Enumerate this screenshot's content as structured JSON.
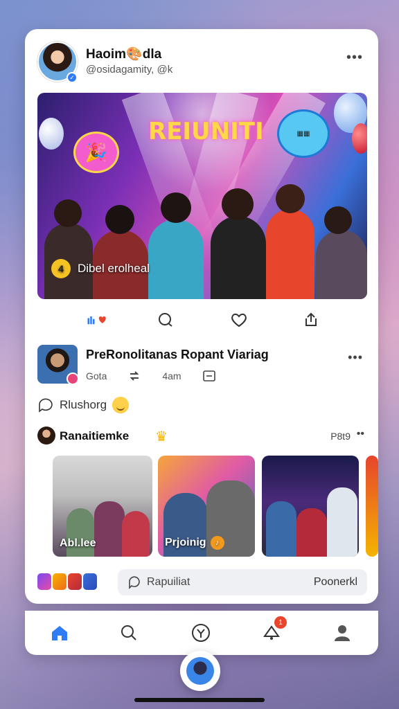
{
  "post": {
    "author_name": "Haoim🎨dla",
    "author_handle": "@osidagamity, @k",
    "more_icon": "more-horizontal-icon",
    "hero": {
      "title": "REIUNITI",
      "caption": "Dibel erolheal",
      "caption_badge": "4",
      "bubble_left": "🎉",
      "bubble_right_top": "▦▦",
      "bubble_right_bottom": "▦▦"
    },
    "actions": [
      "like-reactions-icon",
      "comment-icon",
      "heart-icon",
      "share-icon"
    ]
  },
  "comment": {
    "title": "PreRonolitanas Ropant Viariag",
    "meta": {
      "count": "Gota",
      "time": "4am"
    },
    "icons": [
      "repost-icon",
      "message-square-icon"
    ]
  },
  "reply": {
    "label": "Rlushorg"
  },
  "gallery": {
    "title": "Ranaitiemke",
    "count": "P8t9",
    "items": [
      {
        "label": "Abl.lee"
      },
      {
        "label": "Prjoinig",
        "badge": "♪"
      },
      {
        "label": ""
      },
      {
        "label": ""
      }
    ]
  },
  "composer": {
    "placeholder": "Rapuiliat",
    "action": "Poonerkl"
  },
  "nav": {
    "items": [
      "home-icon",
      "search-icon",
      "create-icon",
      "notifications-icon",
      "profile-icon"
    ],
    "notif_badge": "1"
  },
  "colors": {
    "accent": "#2f7cf6",
    "badge": "#e8452c"
  }
}
